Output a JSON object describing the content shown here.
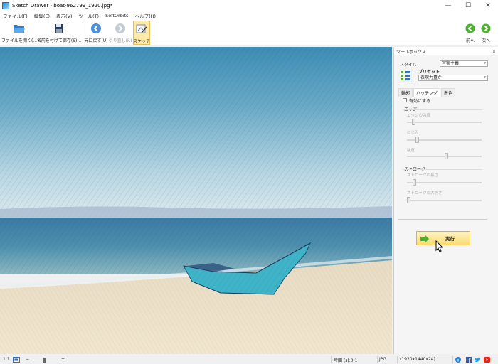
{
  "window": {
    "title": "Sketch Drawer - boat-962799_1920.jpg*"
  },
  "window_controls": {
    "minimize": "—",
    "maximize": "☐",
    "close": "✕"
  },
  "menu": [
    "ファイル(F)",
    "編集(E)",
    "表示(V)",
    "ツール(T)",
    "SoftOrbits",
    "ヘルプ(H)"
  ],
  "toolbar": {
    "open": "ファイルを開く(...",
    "save_as": "名前を付けて保存(S)...",
    "undo": "元に戻す(U)",
    "redo": "やり直し(R)",
    "sketch": "スケッチ",
    "prev": "前へ",
    "next": "次へ"
  },
  "panel": {
    "title": "ツールボックス",
    "close": "×",
    "style_label": "スタイル",
    "style_value": "写実主義",
    "preset_label": "プリセット",
    "preset_value": "表現力豊か",
    "tabs": [
      "輪郭",
      "ハッチング",
      "着色"
    ],
    "selected_tab": "ハッチング",
    "enable_label": "有効にする",
    "enable_checked": false,
    "edge_section": "エッジ",
    "edge_strength": "エッジの強度",
    "blur": "にじみ",
    "intensity": "強度",
    "stroke_section": "ストローク",
    "stroke_length": "ストロークの長さ",
    "stroke_size": "ストロークの大きさ",
    "run": "実行"
  },
  "sliders": {
    "edge_strength": 0.07,
    "blur": 0.12,
    "intensity": 0.53,
    "stroke_length": 0.08,
    "stroke_size": 0.0
  },
  "status": {
    "zoom": "1:1",
    "time": "時間 (s):0.1",
    "format": "JPG",
    "dimensions": "(1920x1440x24)"
  },
  "colors": {
    "accent_green": "#4caf2f",
    "run_button": "#f9dc70",
    "active_tool": "#fde9a8"
  }
}
